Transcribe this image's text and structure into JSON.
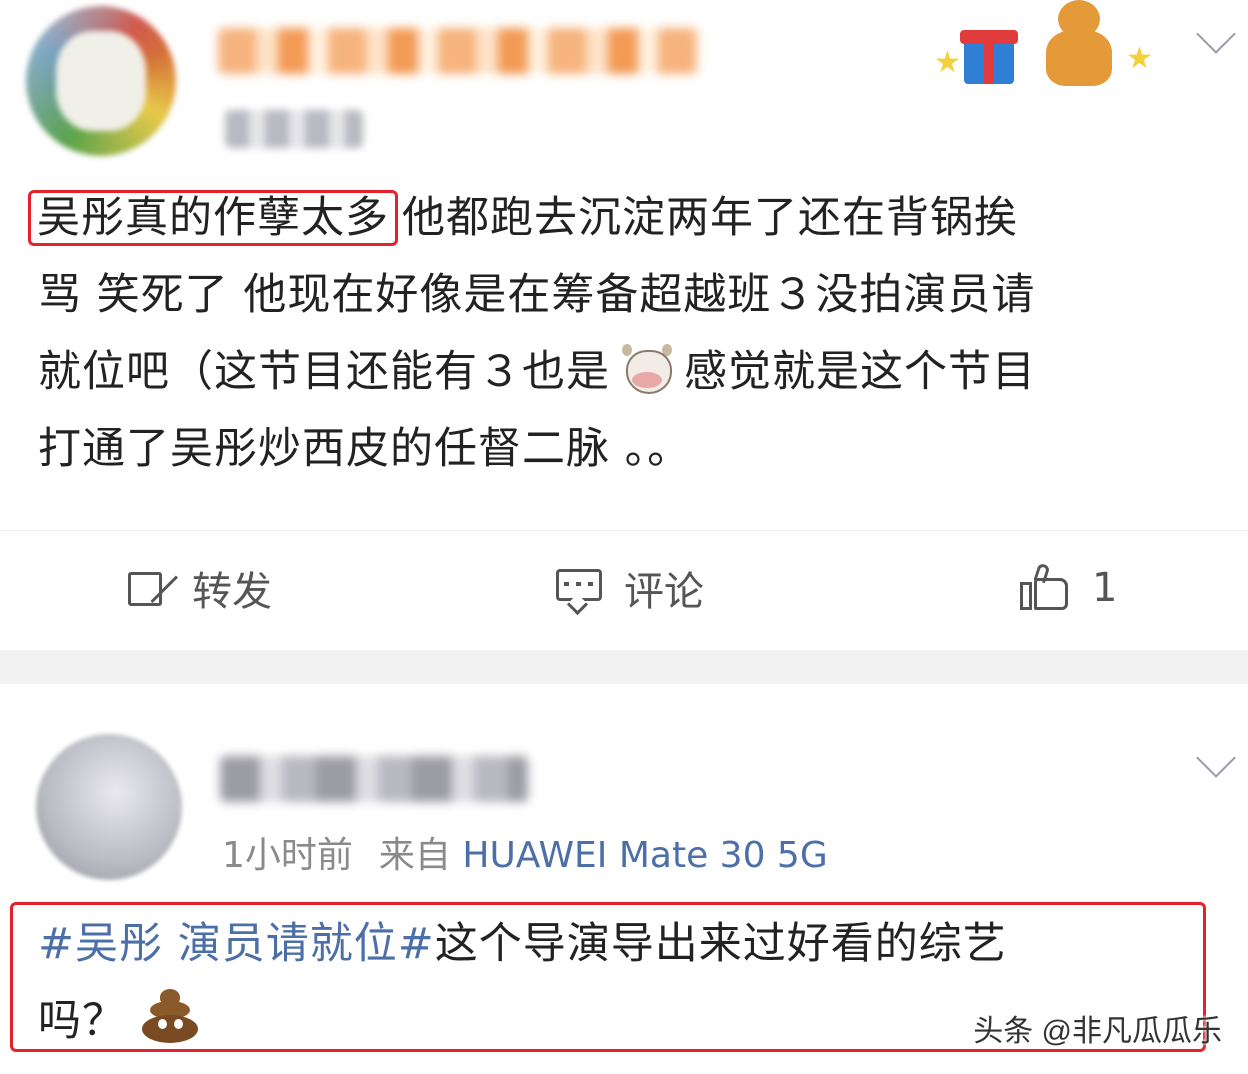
{
  "post1": {
    "highlight_text": "吴彤真的作孽太多",
    "text_line1_rest": "他都跑去沉淀两年了还在背锅挨",
    "text_line2": "骂 笑死了 他现在好像是在筹备超越班３没拍演员请",
    "text_line3_a": "就位吧（这节目还能有３也是",
    "cow_emoji": "cow-face",
    "text_line3_b": "感觉就是这个节目",
    "text_line4": "打通了吴彤炒西皮的任督二脉 。。",
    "actions": {
      "repost_label": "转发",
      "comment_label": "评论",
      "like_count": "1"
    }
  },
  "post2": {
    "time": "1小时前",
    "source_prefix": "来自",
    "device": "HUAWEI Mate 30 5G",
    "hashtag": "#吴彤 演员请就位#",
    "text_rest": "这个导演导出来过好看的综艺",
    "text_line2": "吗？",
    "poop_emoji": "pile-of-poo"
  },
  "watermark": "头条 @非凡瓜瓜乐",
  "colors": {
    "highlight_border": "#e5222b",
    "link_blue": "#4d6fa8",
    "divider_gray": "#f2f2f2"
  }
}
